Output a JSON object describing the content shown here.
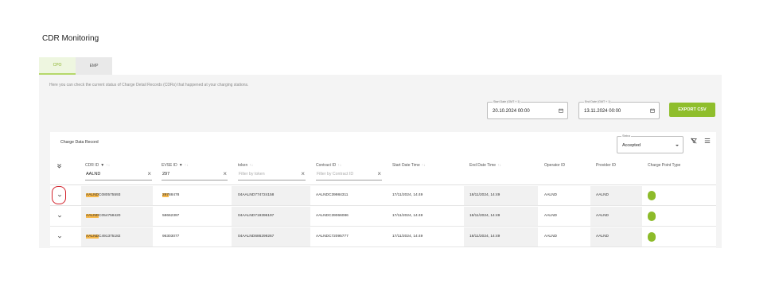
{
  "page": {
    "title": "CDR Monitoring"
  },
  "tabs": [
    {
      "label": "CPO",
      "active": true
    },
    {
      "label": "EMP",
      "active": false
    }
  ],
  "description": "Here you can check the current status of Charge Detail Records (CDRs) that happened at your charging stations.",
  "start_date": {
    "label": "Start Date (GMT + 1)",
    "value": "20.10.2024 00:00"
  },
  "end_date": {
    "label": "End Date (GMT + 1)",
    "value": "13.11.2024 00:00"
  },
  "export_label": "EXPORT CSV",
  "card_title": "Charge Data Record",
  "status": {
    "label": "Status",
    "value": "Accepted"
  },
  "columns": {
    "cdr_id": "CDR ID",
    "evse_id": "EVSE ID",
    "token": "token",
    "contract_id": "Contract ID",
    "start": "Start Date Time",
    "end": "End Date Time",
    "operator": "Operator ID",
    "provider": "Provider ID",
    "cp_type": "Charge Point Type"
  },
  "filters": {
    "cdr_id": "AALND",
    "evse_id": "297",
    "token_placeholder": "Filter by token",
    "contract_placeholder": "Filter by Contract ID"
  },
  "rows": [
    {
      "cdr_hl": "AALND",
      "cdr_rest": "C080575593",
      "evse_hl": "297",
      "evse_rest": "88478",
      "token": "04AALND774724158",
      "contract": "AALNDC39984311",
      "start": "17/11/2024, 14:49",
      "end": "18/11/2024, 14:49",
      "operator": "AALND",
      "provider": "AALND"
    },
    {
      "cdr_hl": "AALND",
      "cdr_rest": "C054758420",
      "evse_hl": "",
      "evse_rest": "58662397",
      "token": "04AALND719396197",
      "contract": "AALNDC39066086",
      "start": "17/11/2024, 14:49",
      "end": "18/11/2024, 14:49",
      "operator": "AALND",
      "provider": "AALND"
    },
    {
      "cdr_hl": "AALND",
      "cdr_rest": "C491375182",
      "evse_hl": "",
      "evse_rest": "96303077",
      "token": "04AALND686299267",
      "contract": "AALNDC72095777",
      "start": "17/11/2024, 14:49",
      "end": "18/11/2024, 14:49",
      "operator": "AALND",
      "provider": "AALND"
    }
  ],
  "colors": {
    "accent": "#8fbe2c",
    "highlight": "#f7b84a",
    "annotation": "#d2212a",
    "status_dot": "#8dbb2a"
  },
  "icons": [
    "calendar-icon",
    "filter-icon",
    "sort-icon",
    "clear-icon",
    "expand-all-icon",
    "chevron-down-icon",
    "filter-off-icon",
    "menu-icon"
  ]
}
